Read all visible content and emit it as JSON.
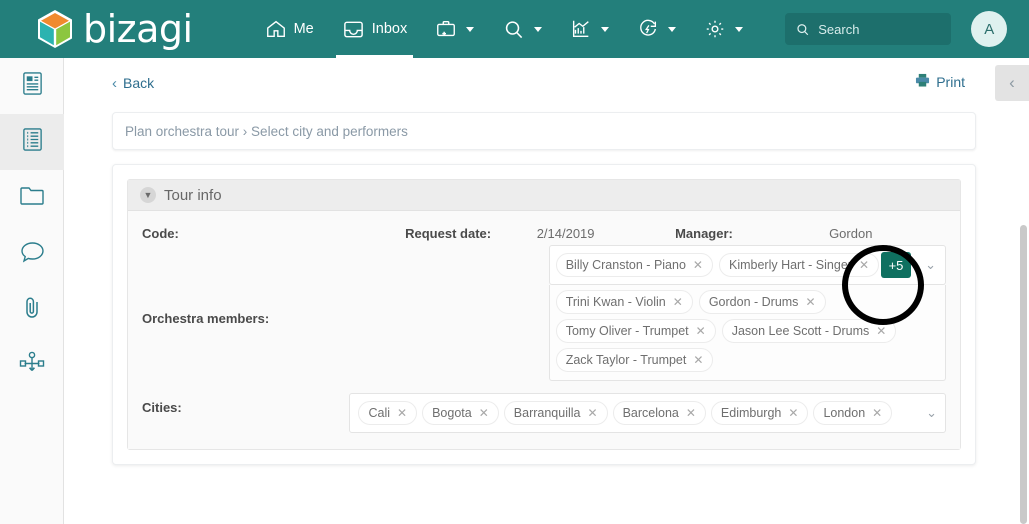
{
  "brand": {
    "name": "bizagi",
    "header_color": "#237f7b",
    "accent_color": "#0f7060"
  },
  "topnav": {
    "items": [
      {
        "label": "Me",
        "icon": "home-icon",
        "has_caret": false,
        "active": false
      },
      {
        "label": "Inbox",
        "icon": "inbox-icon",
        "has_caret": false,
        "active": true
      },
      {
        "label": "",
        "icon": "new-case-icon",
        "has_caret": true,
        "active": false
      },
      {
        "label": "",
        "icon": "search-icon",
        "has_caret": true,
        "active": false
      },
      {
        "label": "",
        "icon": "analytics-icon",
        "has_caret": true,
        "active": false
      },
      {
        "label": "",
        "icon": "refresh-icon",
        "has_caret": true,
        "active": false
      },
      {
        "label": "",
        "icon": "gear-icon",
        "has_caret": true,
        "active": false
      }
    ],
    "search": {
      "placeholder": "Search"
    },
    "avatar": {
      "initial": "A"
    }
  },
  "rail": {
    "items": [
      {
        "icon": "form-icon",
        "active": false
      },
      {
        "icon": "list-icon",
        "active": true
      },
      {
        "icon": "folder-icon",
        "active": false
      },
      {
        "icon": "comment-icon",
        "active": false
      },
      {
        "icon": "attachment-icon",
        "active": false
      },
      {
        "icon": "process-icon",
        "active": false
      }
    ]
  },
  "toolbar": {
    "back_label": "Back",
    "print_label": "Print",
    "collapse_icon": "chevron-left-icon"
  },
  "breadcrumb": {
    "text": "Plan orchestra tour › Select city and performers"
  },
  "form": {
    "panel_title": "Tour info",
    "fields": {
      "code_label": "Code:",
      "code_value": "",
      "request_date_label": "Request date:",
      "request_date_value": "2/14/2019",
      "manager_label": "Manager:",
      "manager_value": "Gordon",
      "members_label": "Orchestra members:",
      "cities_label": "Cities:"
    },
    "members": {
      "visible_tags": [
        {
          "label": "Billy Cranston - Piano"
        },
        {
          "label": "Kimberly Hart - Singer"
        }
      ],
      "overflow_badge": "+5",
      "dropdown_tags": [
        {
          "label": "Trini Kwan - Violin"
        },
        {
          "label": "Gordon - Drums"
        },
        {
          "label": "Tomy Oliver - Trumpet"
        },
        {
          "label": "Jason Lee Scott - Drums"
        },
        {
          "label": "Zack Taylor - Trumpet"
        }
      ]
    },
    "cities": {
      "tags": [
        {
          "label": "Cali"
        },
        {
          "label": "Bogota"
        },
        {
          "label": "Barranquilla"
        },
        {
          "label": "Barcelona"
        },
        {
          "label": "Edimburgh"
        },
        {
          "label": "London"
        }
      ]
    }
  }
}
